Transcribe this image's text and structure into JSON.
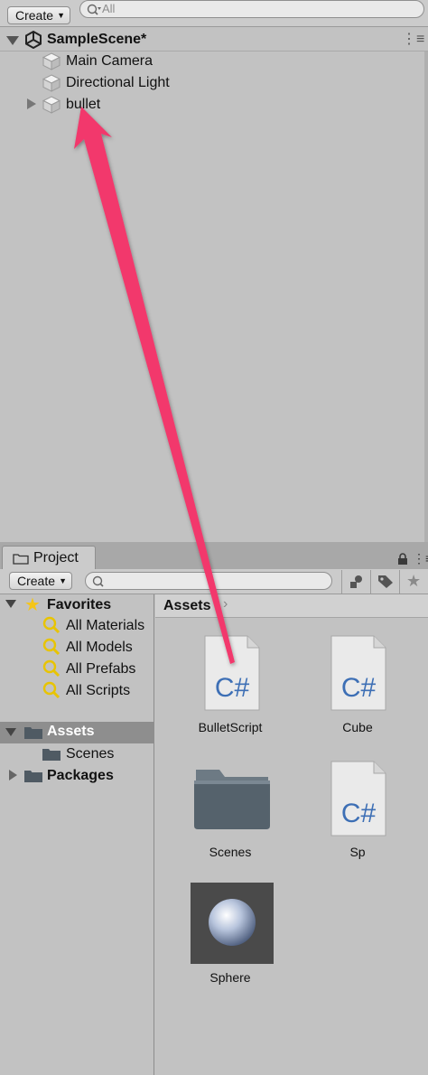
{
  "hierarchy": {
    "create_label": "Create",
    "search_placeholder": "All",
    "scene_name": "SampleScene*",
    "items": [
      {
        "label": "Main Camera"
      },
      {
        "label": "Directional Light"
      },
      {
        "label": "bullet"
      }
    ]
  },
  "project": {
    "tab_label": "Project",
    "create_label": "Create",
    "search_placeholder": "",
    "favorites": {
      "label": "Favorites",
      "items": [
        "All Materials",
        "All Models",
        "All Prefabs",
        "All Scripts"
      ]
    },
    "folders": {
      "assets": "Assets",
      "scenes": "Scenes",
      "packages": "Packages"
    },
    "breadcrumb": "Assets",
    "assets": [
      {
        "name": "BulletScript",
        "type": "script",
        "glyph": "C#"
      },
      {
        "name": "Cube",
        "type": "script",
        "glyph": "C#"
      },
      {
        "name": "Scenes",
        "type": "folder"
      },
      {
        "name": "Sp",
        "type": "script",
        "glyph": "C#"
      },
      {
        "name": "Sphere",
        "type": "material"
      }
    ]
  },
  "annotation": {
    "arrow_color": "#f2386c"
  }
}
